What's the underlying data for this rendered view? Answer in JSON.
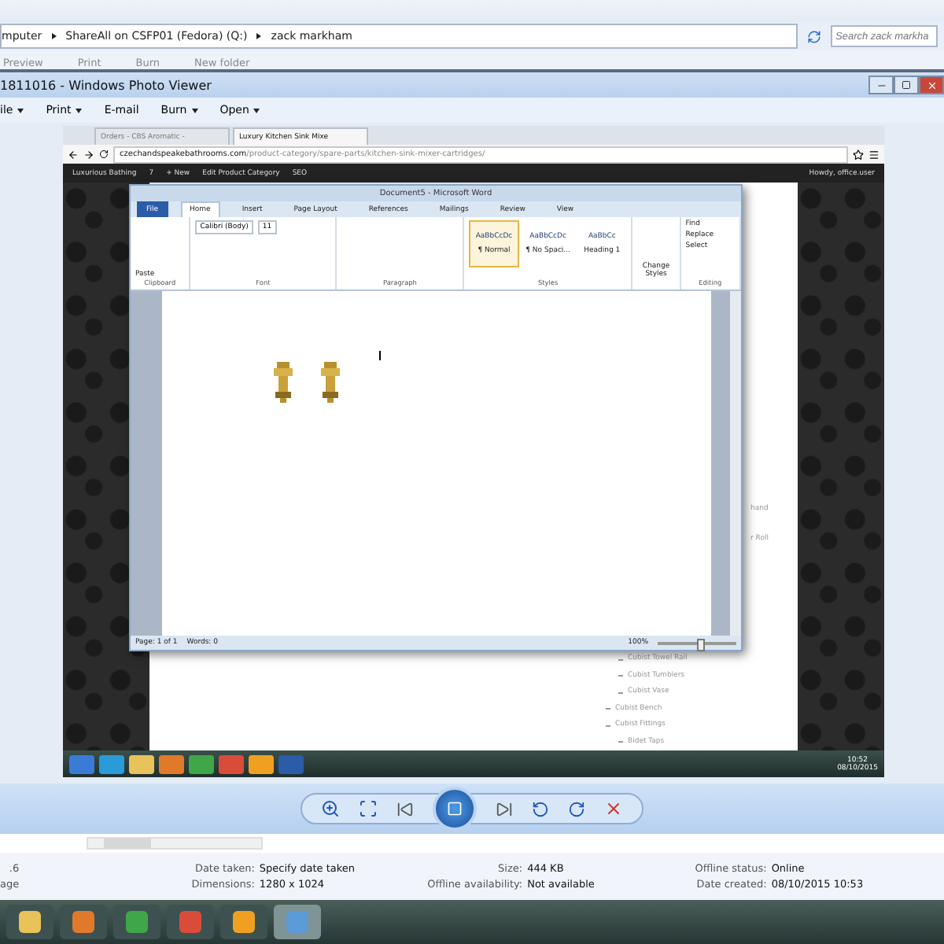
{
  "explorer": {
    "breadcrumbs": [
      "mputer",
      "ShareAll on CSFP01 (Fedora) (Q:)",
      "zack markham"
    ],
    "search": {
      "placeholder": "Search zack markha"
    },
    "toolbar": [
      "Preview",
      "Print",
      "Burn",
      "New folder"
    ]
  },
  "viewer": {
    "title": "1811016 - Windows Photo Viewer",
    "menu": [
      {
        "label": "ile",
        "dropdown": true
      },
      {
        "label": "Print",
        "dropdown": true
      },
      {
        "label": "E-mail",
        "dropdown": false
      },
      {
        "label": "Burn",
        "dropdown": true
      },
      {
        "label": "Open",
        "dropdown": true
      }
    ]
  },
  "browser": {
    "tabs": [
      {
        "label": "Orders - CBS Aromatic -",
        "selected": false
      },
      {
        "label": "Luxury Kitchen Sink Mixe",
        "selected": true
      }
    ],
    "url_host": "czechandspeakebathrooms.com",
    "url_path": "/product-category/spare-parts/kitchen-sink-mixer-cartridges/",
    "admin_bar": {
      "items": [
        "Luxurious Bathing",
        "7",
        "+ New",
        "Edit Product Category",
        "SEO"
      ],
      "greeting": "Howdy, office.user"
    }
  },
  "word": {
    "title": "Document5 - Microsoft Word",
    "tabs": [
      {
        "label": "File",
        "selected": false,
        "kind": "file"
      },
      {
        "label": "Home",
        "selected": true,
        "kind": "tab"
      },
      {
        "label": "Insert",
        "selected": false,
        "kind": "tab"
      },
      {
        "label": "Page Layout",
        "selected": false,
        "kind": "tab"
      },
      {
        "label": "References",
        "selected": false,
        "kind": "tab"
      },
      {
        "label": "Mailings",
        "selected": false,
        "kind": "tab"
      },
      {
        "label": "Review",
        "selected": false,
        "kind": "tab"
      },
      {
        "label": "View",
        "selected": false,
        "kind": "tab"
      }
    ],
    "paste": "Paste",
    "font": "Calibri (Body)",
    "size": "11",
    "styles": [
      {
        "sample": "AaBbCcDc",
        "name": "¶ Normal",
        "selected": true
      },
      {
        "sample": "AaBbCcDc",
        "name": "¶ No Spaci...",
        "selected": false
      },
      {
        "sample": "AaBbCc",
        "name": "Heading 1",
        "selected": false
      }
    ],
    "change_styles": "Change Styles",
    "editing": [
      "Find",
      "Replace",
      "Select"
    ],
    "groups": [
      "Clipboard",
      "Font",
      "Paragraph",
      "Styles",
      "Editing"
    ],
    "status": [
      "Page: 1 of 1",
      "Words: 0"
    ],
    "zoom": "100%",
    "zoom_slider": {
      "level": 0.5
    }
  },
  "page": {
    "partial_links": [
      "hand",
      "r Roll"
    ],
    "categories": [
      {
        "label": "Cubist Towel Rail"
      },
      {
        "label": "Cubist Tumblers"
      },
      {
        "label": "Cubist Vase"
      }
    ],
    "top_categories": [
      {
        "label": "Cubist Bench"
      },
      {
        "label": "Cubist Fittings",
        "children": [
          {
            "label": "Bidet Taps"
          }
        ]
      }
    ]
  },
  "inner_taskbar": {
    "time": "10:52",
    "date": "08/10/2015"
  },
  "details": [
    {
      "label": ".6"
    },
    {
      "label": "Date taken:",
      "value": "Specify date taken"
    },
    {
      "label": "Size:",
      "value": "444 KB"
    },
    {
      "label": "Offline status:",
      "value": "Online"
    },
    {
      "label": "age"
    },
    {
      "label": "Dimensions:",
      "value": "1280 x 1024"
    },
    {
      "label": "Offline availability:",
      "value": "Not available"
    },
    {
      "label": "Date created:",
      "value": "08/10/2015 10:53"
    }
  ]
}
